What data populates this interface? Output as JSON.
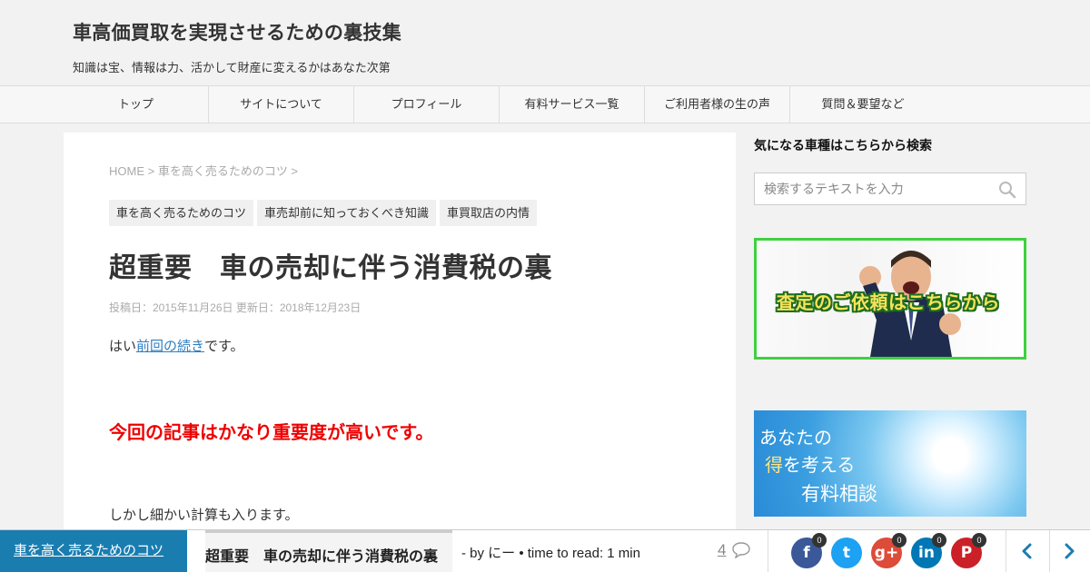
{
  "site": {
    "title": "車高価買取を実現させるための裏技集",
    "description": "知識は宝、情報は力、活かして財産に変えるかはあなた次第"
  },
  "nav": {
    "items": [
      {
        "label": "トップ"
      },
      {
        "label": "サイトについて"
      },
      {
        "label": "プロフィール"
      },
      {
        "label": "有料サービス一覧"
      },
      {
        "label": "ご利用者様の生の声"
      },
      {
        "label": "質問＆要望など"
      }
    ]
  },
  "post": {
    "breadcrumb": "HOME > 車を高く売るためのコツ >",
    "tags": [
      "車を高く売るためのコツ",
      "車売却前に知っておくべき知識",
      "車買取店の内情"
    ],
    "title": "超重要　車の売却に伴う消費税の裏",
    "dates": "投稿日：2015年11月26日 更新日：2018年12月23日",
    "p1_before": "はい",
    "p1_link": "前回の続き",
    "p1_after": "です。",
    "emphasis": "今回の記事はかなり重要度が高いです。",
    "p3": "しかし細かい計算も入ります。"
  },
  "sidebar": {
    "heading": "気になる車種はこちらから検索",
    "search_placeholder": "検索するテキストを入力",
    "banner1_text": "査定のご依頼はこちらから",
    "banner2_line1": "あなたの",
    "banner2_line2_accent": "得",
    "banner2_line2_rest": "を考える",
    "banner2_line3": "有料相談"
  },
  "bottombar": {
    "category": "車を高く売るためのコツ",
    "title": "超重要　車の売却に伴う消費税の裏",
    "meta": "-  by にー   •   time to read: 1 min",
    "comments": "4",
    "social": [
      {
        "name": "facebook",
        "glyph": "f",
        "count": "0",
        "color": "#3b5998"
      },
      {
        "name": "twitter",
        "glyph": "t",
        "count": "",
        "color": "#1da1f2"
      },
      {
        "name": "google-plus",
        "glyph": "g+",
        "count": "0",
        "color": "#dd4b39"
      },
      {
        "name": "linkedin",
        "glyph": "in",
        "count": "0",
        "color": "#0077b5"
      },
      {
        "name": "pinterest",
        "glyph": "P",
        "count": "0",
        "color": "#cb2027"
      }
    ]
  }
}
